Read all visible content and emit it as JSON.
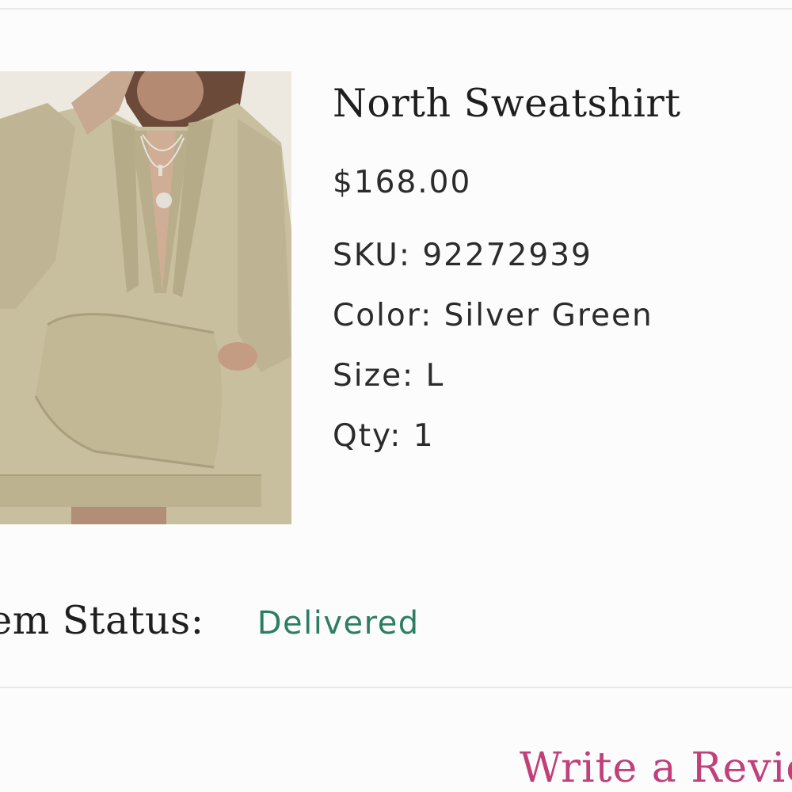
{
  "product": {
    "name": "North Sweatshirt",
    "price": "$168.00",
    "sku_line": "SKU: 92272939",
    "color_line": "Color: Silver Green",
    "size_line": "Size: L",
    "qty_line": "Qty: 1",
    "image_icon": "product-photo"
  },
  "status": {
    "label": "tem Status:",
    "value": "Delivered",
    "value_color": "#2b7e64"
  },
  "actions": {
    "review_label": "Write a Revie",
    "review_color": "#c0407c"
  }
}
